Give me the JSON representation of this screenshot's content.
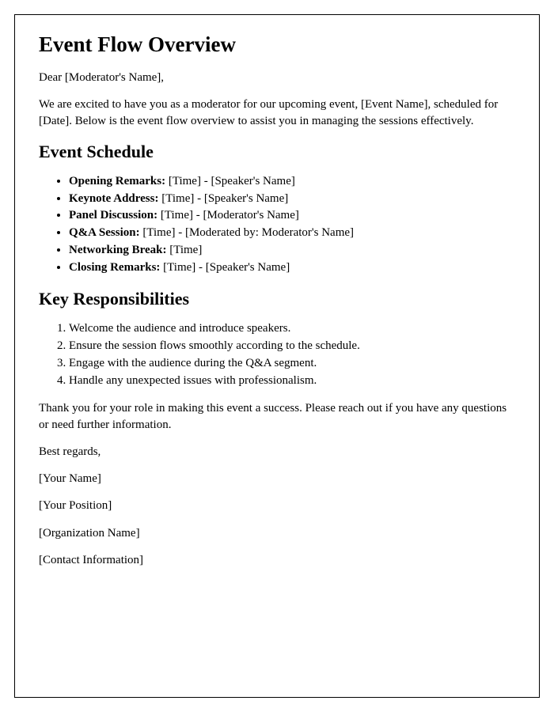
{
  "title": "Event Flow Overview",
  "greeting": "Dear [Moderator's Name],",
  "intro": "We are excited to have you as a moderator for our upcoming event, [Event Name], scheduled for [Date]. Below is the event flow overview to assist you in managing the sessions effectively.",
  "schedule": {
    "heading": "Event Schedule",
    "items": [
      {
        "label": "Opening Remarks:",
        "detail": " [Time] - [Speaker's Name]"
      },
      {
        "label": "Keynote Address:",
        "detail": " [Time] - [Speaker's Name]"
      },
      {
        "label": "Panel Discussion:",
        "detail": " [Time] - [Moderator's Name]"
      },
      {
        "label": "Q&A Session:",
        "detail": " [Time] - [Moderated by: Moderator's Name]"
      },
      {
        "label": "Networking Break:",
        "detail": " [Time]"
      },
      {
        "label": "Closing Remarks:",
        "detail": " [Time] - [Speaker's Name]"
      }
    ]
  },
  "responsibilities": {
    "heading": "Key Responsibilities",
    "items": [
      "Welcome the audience and introduce speakers.",
      "Ensure the session flows smoothly according to the schedule.",
      "Engage with the audience during the Q&A segment.",
      "Handle any unexpected issues with professionalism."
    ]
  },
  "thanks": "Thank you for your role in making this event a success. Please reach out if you have any questions or need further information.",
  "closing": "Best regards,",
  "signature": {
    "name": "[Your Name]",
    "position": "[Your Position]",
    "organization": "[Organization Name]",
    "contact": "[Contact Information]"
  }
}
